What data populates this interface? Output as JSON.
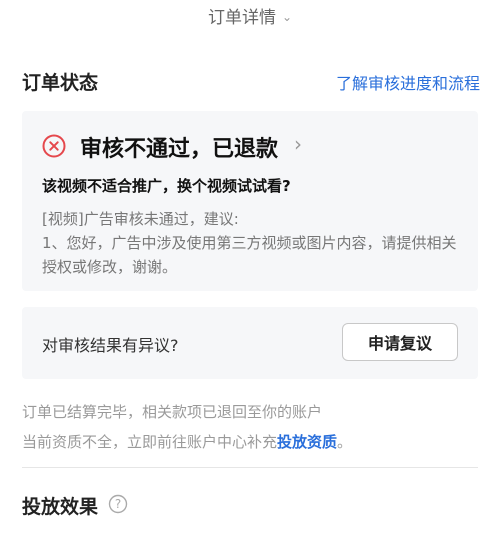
{
  "header": {
    "title": "订单详情",
    "chevron_icon": "chevron-down-icon"
  },
  "order_status": {
    "title": "订单状态",
    "link_label": "了解审核进度和流程",
    "link_color": "#2a6fdb"
  },
  "status_card": {
    "icon": "error-circle-x-icon",
    "icon_color": "#e5484d",
    "status_title": "审核不通过，已退款",
    "subtitle": "该视频不适合推广，换个视频试试看?",
    "reason_line1": "[视频]广告审核未通过，建议:",
    "reason_line2": "1、您好，广告中涉及使用第三方视频或图片内容，请提供相关授权或修改，谢谢。"
  },
  "appeal": {
    "question": "对审核结果有异议?",
    "button_label": "申请复议"
  },
  "notes": {
    "line1": "订单已结算完毕，相关款项已退回至你的账户",
    "line2_prefix": "当前资质不全，立即前往账户中心补充",
    "line2_link": "投放资质",
    "line2_suffix": "。"
  },
  "effect": {
    "title": "投放效果",
    "help_icon": "question-circle-icon"
  }
}
